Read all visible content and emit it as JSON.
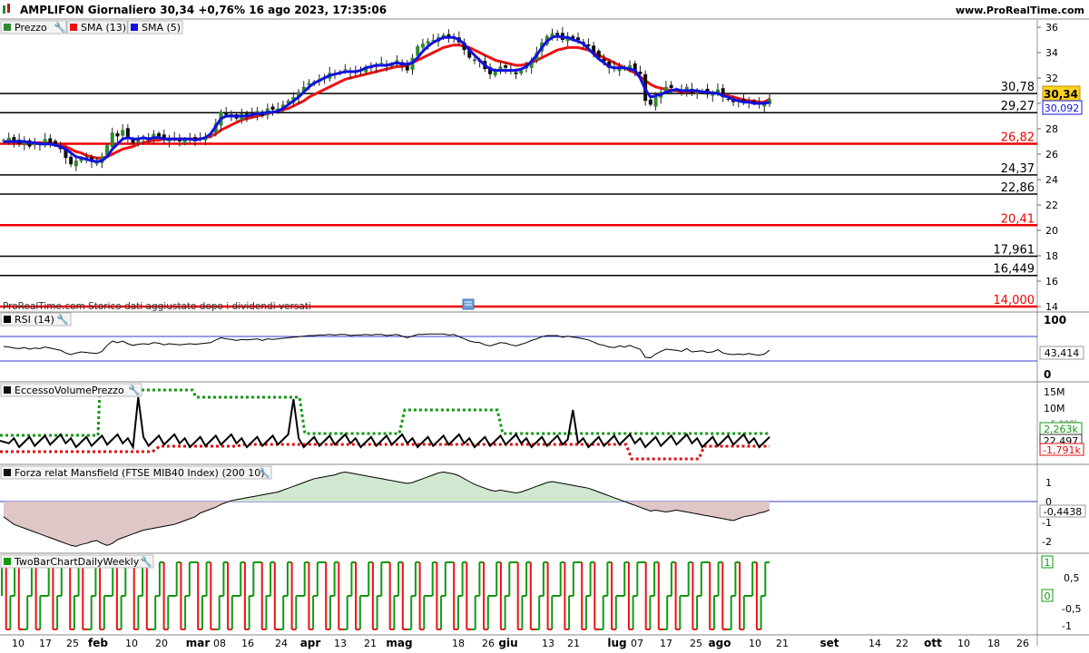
{
  "header": {
    "title": "AMPLIFON Giornaliero 30,34 +0,76% 16 ago 2023, 17:35:06",
    "site": "www.ProRealTime.com"
  },
  "colors": {
    "up": "#2e8b2e",
    "down": "#111111",
    "sma13": "#ee1111",
    "sma5": "#1111dd",
    "support_black": "#000000",
    "support_red": "#ee0000",
    "rsi_band": "#3b3bcc",
    "evp_upper": "#119911",
    "evp_lower": "#dd1111",
    "mansfield_pos": "#9cd39c",
    "mansfield_neg": "#c79a9a",
    "twobar_green": "#119911",
    "twobar_red": "#ee1111"
  },
  "legend": {
    "prezzo": "Prezzo",
    "sma13": "SMA (13)",
    "sma5": "SMA (5)"
  },
  "note": "ProRealTime.com  Storico dati aggiustato dopo i dividendi versati",
  "panels": {
    "rsi": "RSI (14)",
    "evp": "EccessoVolumePrezzo",
    "mansfield": "Forza relat Mansfield (FTSE MIB40 Index) (200 10)",
    "twobar": "TwoBarChartDailyWeekly"
  },
  "chart_data": [
    {
      "type": "candlestick",
      "title": "AMPLIFON Giornaliero",
      "ylim": [
        14,
        36
      ],
      "y_ticks": [
        "36",
        "34",
        "32",
        "30",
        "28",
        "26",
        "24",
        "22",
        "20",
        "18",
        "16",
        "14"
      ],
      "current_price": "30,34",
      "sma5_value": "30,092",
      "levels": [
        {
          "label": "30,78",
          "value": 30.78,
          "color": "black"
        },
        {
          "label": "29,27",
          "value": 29.27,
          "color": "black"
        },
        {
          "label": "26,82",
          "value": 26.82,
          "color": "red"
        },
        {
          "label": "24,37",
          "value": 24.37,
          "color": "black"
        },
        {
          "label": "22,86",
          "value": 22.86,
          "color": "black"
        },
        {
          "label": "20,41",
          "value": 20.41,
          "color": "red"
        },
        {
          "label": "17,961",
          "value": 17.961,
          "color": "black"
        },
        {
          "label": "16,449",
          "value": 16.449,
          "color": "black"
        },
        {
          "label": "14,000",
          "value": 14.0,
          "color": "red"
        }
      ],
      "closes": [
        27.1,
        27.3,
        27.0,
        26.8,
        27.1,
        26.6,
        26.9,
        26.8,
        27.2,
        26.9,
        26.7,
        26.4,
        25.7,
        25.2,
        25.5,
        25.7,
        25.6,
        25.4,
        25.3,
        25.8,
        26.7,
        27.7,
        27.4,
        27.9,
        27.3,
        26.9,
        27.1,
        27.3,
        27.2,
        27.6,
        27.4,
        27.1,
        27.3,
        27.2,
        27.0,
        27.2,
        27.3,
        27.1,
        27.2,
        27.4,
        27.6,
        28.4,
        29.3,
        29.1,
        29.0,
        28.8,
        29.2,
        29.0,
        29.2,
        29.4,
        29.0,
        29.6,
        29.5,
        29.6,
        29.9,
        30.2,
        30.5,
        30.9,
        31.3,
        31.6,
        31.7,
        31.9,
        32.1,
        32.4,
        32.3,
        32.5,
        32.7,
        32.4,
        32.5,
        32.6,
        32.9,
        32.8,
        33.0,
        33.2,
        32.9,
        33.1,
        33.4,
        33.0,
        32.6,
        33.6,
        34.5,
        34.7,
        34.9,
        35.0,
        35.2,
        35.4,
        35.1,
        35.3,
        34.8,
        34.2,
        33.6,
        33.4,
        33.3,
        32.7,
        32.3,
        32.6,
        32.9,
        32.8,
        32.5,
        32.3,
        32.6,
        32.9,
        33.4,
        34.0,
        34.8,
        35.3,
        35.5,
        35.4,
        35.0,
        35.3,
        35.1,
        35.0,
        34.7,
        34.5,
        34.0,
        33.6,
        33.3,
        32.8,
        32.7,
        32.9,
        32.7,
        33.0,
        32.6,
        32.3,
        30.2,
        29.9,
        30.5,
        30.9,
        31.3,
        31.2,
        31.1,
        30.9,
        31.3,
        30.8,
        30.9,
        31.0,
        30.7,
        30.8,
        31.1,
        30.5,
        30.3,
        30.1,
        30.2,
        30.1,
        30.2,
        30.0,
        29.9,
        30.0,
        30.34
      ],
      "sma5": [
        27.0,
        27.0,
        27.0,
        27.0,
        27.0,
        26.9,
        26.9,
        26.8,
        26.8,
        26.8,
        26.7,
        26.6,
        26.4,
        26.1,
        25.8,
        25.7,
        25.6,
        25.5,
        25.4,
        25.5,
        25.8,
        26.4,
        26.8,
        27.2,
        27.3,
        27.2,
        27.2,
        27.3,
        27.2,
        27.3,
        27.3,
        27.2,
        27.2,
        27.2,
        27.2,
        27.2,
        27.2,
        27.1,
        27.2,
        27.3,
        27.6,
        28.2,
        28.8,
        29.0,
        29.0,
        29.0,
        29.0,
        29.0,
        29.1,
        29.2,
        29.2,
        29.3,
        29.3,
        29.4,
        29.6,
        29.9,
        30.2,
        30.5,
        30.9,
        31.3,
        31.6,
        31.8,
        32.0,
        32.2,
        32.3,
        32.4,
        32.5,
        32.5,
        32.5,
        32.6,
        32.8,
        32.9,
        33.0,
        33.0,
        33.0,
        33.1,
        33.2,
        33.1,
        33.1,
        33.2,
        33.6,
        34.1,
        34.5,
        34.8,
        35.0,
        35.2,
        35.2,
        35.2,
        35.0,
        34.7,
        34.2,
        33.8,
        33.4,
        33.0,
        32.7,
        32.6,
        32.6,
        32.6,
        32.6,
        32.6,
        32.7,
        32.9,
        33.3,
        33.8,
        34.4,
        34.9,
        35.2,
        35.3,
        35.2,
        35.2,
        35.0,
        34.9,
        34.7,
        34.3,
        33.9,
        33.5,
        33.2,
        32.9,
        32.8,
        32.8,
        32.8,
        32.7,
        32.6,
        32.0,
        31.1,
        30.5,
        30.6,
        30.7,
        30.9,
        31.0,
        31.1,
        31.0,
        31.0,
        31.0,
        31.0,
        30.9,
        30.9,
        30.8,
        30.8,
        30.6,
        30.5,
        30.3,
        30.2,
        30.1,
        30.1,
        30.0,
        30.0,
        30.0,
        30.09
      ],
      "sma13": [
        26.9,
        26.9,
        26.9,
        26.9,
        26.9,
        26.9,
        26.9,
        26.9,
        26.9,
        26.9,
        26.8,
        26.7,
        26.6,
        26.4,
        26.2,
        26.1,
        25.9,
        25.8,
        25.7,
        25.7,
        25.8,
        26.0,
        26.2,
        26.4,
        26.5,
        26.6,
        26.8,
        26.9,
        27.0,
        27.1,
        27.1,
        27.2,
        27.2,
        27.2,
        27.2,
        27.2,
        27.2,
        27.2,
        27.2,
        27.3,
        27.4,
        27.6,
        27.9,
        28.1,
        28.3,
        28.5,
        28.7,
        28.8,
        28.9,
        29.0,
        29.1,
        29.2,
        29.3,
        29.4,
        29.5,
        29.6,
        29.8,
        30.0,
        30.2,
        30.5,
        30.7,
        30.9,
        31.1,
        31.3,
        31.5,
        31.7,
        31.9,
        32.0,
        32.1,
        32.2,
        32.3,
        32.4,
        32.5,
        32.6,
        32.7,
        32.8,
        32.9,
        32.9,
        33.0,
        33.2,
        33.4,
        33.6,
        33.8,
        34.0,
        34.2,
        34.4,
        34.5,
        34.6,
        34.6,
        34.5,
        34.4,
        34.2,
        34.0,
        33.8,
        33.6,
        33.4,
        33.3,
        33.2,
        33.1,
        33.0,
        33.0,
        33.1,
        33.2,
        33.4,
        33.6,
        33.8,
        34.0,
        34.2,
        34.3,
        34.4,
        34.4,
        34.4,
        34.3,
        34.2,
        34.0,
        33.8,
        33.6,
        33.4,
        33.2,
        33.0,
        32.8,
        32.6,
        32.4,
        32.1,
        31.8,
        31.5,
        31.3,
        31.2,
        31.1,
        31.0,
        31.0,
        30.9,
        30.9,
        30.9,
        30.9,
        30.9,
        30.9,
        30.8,
        30.8,
        30.7,
        30.6,
        30.5,
        30.4,
        30.3,
        30.2,
        30.2,
        30.1,
        30.1,
        30.34
      ]
    },
    {
      "type": "line",
      "title": "RSI (14)",
      "ylim": [
        0,
        100
      ],
      "y_ticks": [
        "100",
        "0"
      ],
      "bands": [
        70,
        30
      ],
      "current": "43,414",
      "values": [
        50,
        49,
        47,
        46,
        48,
        45,
        47,
        46,
        49,
        47,
        45,
        43,
        38,
        35,
        38,
        40,
        39,
        38,
        37,
        41,
        52,
        60,
        57,
        60,
        55,
        52,
        54,
        55,
        54,
        57,
        56,
        53,
        55,
        54,
        53,
        54,
        55,
        54,
        55,
        56,
        57,
        62,
        66,
        64,
        63,
        61,
        63,
        62,
        63,
        64,
        61,
        64,
        63,
        64,
        65,
        66,
        67,
        68,
        69,
        70,
        70,
        71,
        71,
        72,
        71,
        72,
        72,
        70,
        71,
        71,
        72,
        71,
        72,
        72,
        70,
        71,
        72,
        69,
        66,
        69,
        72,
        72,
        73,
        73,
        73,
        73,
        71,
        72,
        68,
        64,
        60,
        58,
        57,
        53,
        51,
        54,
        57,
        56,
        53,
        51,
        54,
        57,
        61,
        64,
        68,
        70,
        70,
        70,
        67,
        69,
        67,
        66,
        64,
        62,
        58,
        54,
        52,
        49,
        48,
        51,
        49,
        52,
        48,
        45,
        30,
        29,
        36,
        41,
        45,
        44,
        43,
        41,
        46,
        40,
        41,
        42,
        39,
        40,
        44,
        38,
        36,
        35,
        36,
        35,
        37,
        35,
        34,
        36,
        43.4
      ]
    },
    {
      "type": "line",
      "title": "EccessoVolumePrezzo",
      "y_ticks": [
        "15M",
        "10M",
        "5.000k"
      ],
      "labels": [
        "2,263k",
        "22,497",
        "-1,791k"
      ]
    },
    {
      "type": "area",
      "title": "Forza relat Mansfield (FTSE MIB40 Index) (200 10)",
      "ylim": [
        -2.5,
        1.8
      ],
      "y_ticks": [
        "1",
        "0",
        "-1",
        "-2"
      ],
      "current": "-0,4438",
      "values": [
        -0.8,
        -1.0,
        -1.2,
        -1.3,
        -1.4,
        -1.5,
        -1.6,
        -1.7,
        -1.8,
        -1.9,
        -2.0,
        -2.1,
        -2.2,
        -2.3,
        -2.35,
        -2.25,
        -2.2,
        -2.1,
        -2.05,
        -2.2,
        -2.3,
        -2.2,
        -2.0,
        -1.9,
        -1.8,
        -1.7,
        -1.6,
        -1.5,
        -1.45,
        -1.4,
        -1.35,
        -1.3,
        -1.25,
        -1.2,
        -1.1,
        -1.0,
        -0.9,
        -0.8,
        -0.6,
        -0.5,
        -0.4,
        -0.3,
        -0.15,
        -0.05,
        0.05,
        0.1,
        0.15,
        0.2,
        0.25,
        0.3,
        0.35,
        0.4,
        0.45,
        0.5,
        0.6,
        0.7,
        0.8,
        0.9,
        1.0,
        1.1,
        1.2,
        1.25,
        1.3,
        1.35,
        1.4,
        1.5,
        1.55,
        1.5,
        1.45,
        1.4,
        1.35,
        1.3,
        1.25,
        1.2,
        1.15,
        1.1,
        1.05,
        1.0,
        0.95,
        1.0,
        1.1,
        1.2,
        1.3,
        1.4,
        1.5,
        1.55,
        1.5,
        1.45,
        1.35,
        1.2,
        1.05,
        0.9,
        0.8,
        0.7,
        0.6,
        0.55,
        0.6,
        0.55,
        0.5,
        0.45,
        0.5,
        0.6,
        0.7,
        0.8,
        0.9,
        1.0,
        1.05,
        1.0,
        0.95,
        0.9,
        0.85,
        0.8,
        0.75,
        0.7,
        0.6,
        0.5,
        0.4,
        0.3,
        0.2,
        0.1,
        0.0,
        -0.1,
        -0.2,
        -0.3,
        -0.4,
        -0.5,
        -0.45,
        -0.5,
        -0.55,
        -0.5,
        -0.45,
        -0.5,
        -0.55,
        -0.6,
        -0.65,
        -0.7,
        -0.75,
        -0.8,
        -0.85,
        -0.9,
        -0.95,
        -1.0,
        -0.9,
        -0.8,
        -0.75,
        -0.7,
        -0.6,
        -0.55,
        -0.44
      ]
    },
    {
      "type": "line",
      "title": "TwoBarChartDailyWeekly",
      "ylim": [
        -1.2,
        1.2
      ],
      "y_ticks": [
        "1",
        "0,5",
        "0",
        "-0,5",
        "-1"
      ],
      "labels": [
        "1",
        "0"
      ]
    }
  ],
  "x_axis": {
    "months": [
      "feb",
      "mar",
      "apr",
      "mag",
      "giu",
      "lug",
      "ago",
      "set",
      "ott"
    ],
    "days": [
      "10",
      "17",
      "25",
      "10",
      "20",
      "08",
      "16",
      "24",
      "13",
      "21",
      "18",
      "26",
      "13",
      "21",
      "07",
      "17",
      "25",
      "10",
      "21",
      "14",
      "22",
      "10",
      "18",
      "26"
    ]
  }
}
